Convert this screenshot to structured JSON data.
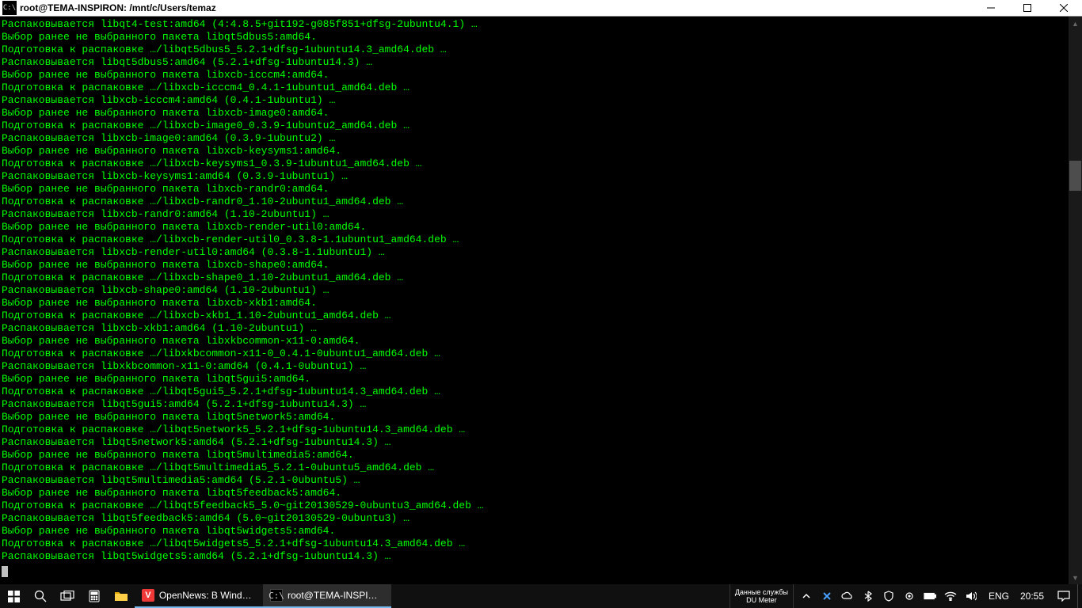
{
  "window": {
    "icon_text": "C:\\",
    "title": "root@TEMA-INSPIRON: /mnt/c/Users/temaz",
    "minimize_aria": "Minimize",
    "maximize_aria": "Maximize",
    "close_aria": "Close"
  },
  "terminal": {
    "lines": [
      "Распаковывается libqt4-test:amd64 (4:4.8.5+git192-g085f851+dfsg-2ubuntu4.1) …",
      "Выбор ранее не выбранного пакета libqt5dbus5:amd64.",
      "Подготовка к распаковке …/libqt5dbus5_5.2.1+dfsg-1ubuntu14.3_amd64.deb …",
      "Распаковывается libqt5dbus5:amd64 (5.2.1+dfsg-1ubuntu14.3) …",
      "Выбор ранее не выбранного пакета libxcb-icccm4:amd64.",
      "Подготовка к распаковке …/libxcb-icccm4_0.4.1-1ubuntu1_amd64.deb …",
      "Распаковывается libxcb-icccm4:amd64 (0.4.1-1ubuntu1) …",
      "Выбор ранее не выбранного пакета libxcb-image0:amd64.",
      "Подготовка к распаковке …/libxcb-image0_0.3.9-1ubuntu2_amd64.deb …",
      "Распаковывается libxcb-image0:amd64 (0.3.9-1ubuntu2) …",
      "Выбор ранее не выбранного пакета libxcb-keysyms1:amd64.",
      "Подготовка к распаковке …/libxcb-keysyms1_0.3.9-1ubuntu1_amd64.deb …",
      "Распаковывается libxcb-keysyms1:amd64 (0.3.9-1ubuntu1) …",
      "Выбор ранее не выбранного пакета libxcb-randr0:amd64.",
      "Подготовка к распаковке …/libxcb-randr0_1.10-2ubuntu1_amd64.deb …",
      "Распаковывается libxcb-randr0:amd64 (1.10-2ubuntu1) …",
      "Выбор ранее не выбранного пакета libxcb-render-util0:amd64.",
      "Подготовка к распаковке …/libxcb-render-util0_0.3.8-1.1ubuntu1_amd64.deb …",
      "Распаковывается libxcb-render-util0:amd64 (0.3.8-1.1ubuntu1) …",
      "Выбор ранее не выбранного пакета libxcb-shape0:amd64.",
      "Подготовка к распаковке …/libxcb-shape0_1.10-2ubuntu1_amd64.deb …",
      "Распаковывается libxcb-shape0:amd64 (1.10-2ubuntu1) …",
      "Выбор ранее не выбранного пакета libxcb-xkb1:amd64.",
      "Подготовка к распаковке …/libxcb-xkb1_1.10-2ubuntu1_amd64.deb …",
      "Распаковывается libxcb-xkb1:amd64 (1.10-2ubuntu1) …",
      "Выбор ранее не выбранного пакета libxkbcommon-x11-0:amd64.",
      "Подготовка к распаковке …/libxkbcommon-x11-0_0.4.1-0ubuntu1_amd64.deb …",
      "Распаковывается libxkbcommon-x11-0:amd64 (0.4.1-0ubuntu1) …",
      "Выбор ранее не выбранного пакета libqt5gui5:amd64.",
      "Подготовка к распаковке …/libqt5gui5_5.2.1+dfsg-1ubuntu14.3_amd64.deb …",
      "Распаковывается libqt5gui5:amd64 (5.2.1+dfsg-1ubuntu14.3) …",
      "Выбор ранее не выбранного пакета libqt5network5:amd64.",
      "Подготовка к распаковке …/libqt5network5_5.2.1+dfsg-1ubuntu14.3_amd64.deb …",
      "Распаковывается libqt5network5:amd64 (5.2.1+dfsg-1ubuntu14.3) …",
      "Выбор ранее не выбранного пакета libqt5multimedia5:amd64.",
      "Подготовка к распаковке …/libqt5multimedia5_5.2.1-0ubuntu5_amd64.deb …",
      "Распаковывается libqt5multimedia5:amd64 (5.2.1-0ubuntu5) …",
      "Выбор ранее не выбранного пакета libqt5feedback5:amd64.",
      "Подготовка к распаковке …/libqt5feedback5_5.0~git20130529-0ubuntu3_amd64.deb …",
      "Распаковывается libqt5feedback5:amd64 (5.0~git20130529-0ubuntu3) …",
      "Выбор ранее не выбранного пакета libqt5widgets5:amd64.",
      "Подготовка к распаковке …/libqt5widgets5_5.2.1+dfsg-1ubuntu14.3_amd64.deb …",
      "Распаковывается libqt5widgets5:amd64 (5.2.1+dfsg-1ubuntu14.3) …"
    ]
  },
  "taskbar": {
    "tasks": [
      {
        "name": "vivaldi",
        "label": "OpenNews: В Windo…",
        "active": false
      },
      {
        "name": "terminal",
        "label": "root@TEMA-INSPIRO…",
        "active": true
      }
    ],
    "dumeter": {
      "line1": "Данные службы",
      "line2": "DU Meter"
    },
    "lang": "ENG",
    "clock": "20:55"
  }
}
